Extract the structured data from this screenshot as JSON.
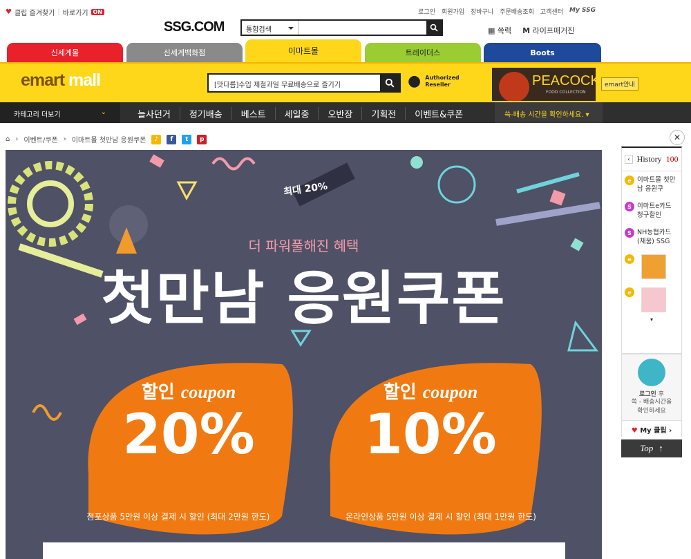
{
  "util": {
    "bookmark": "클립 즐겨찾기",
    "shortcut": "바로가기",
    "on": "ON",
    "links": [
      "로그인",
      "회원가입",
      "장바구니",
      "주문배송조회",
      "고객센터",
      "My SSG"
    ]
  },
  "header": {
    "logo": "SSG.COM",
    "search_select": "통합검색",
    "search_placeholder": "",
    "links": [
      "쓱력",
      "라이프매거진"
    ]
  },
  "tabs": [
    {
      "label": "신세계몰",
      "color": "#e8212b"
    },
    {
      "label": "신세계백화점",
      "color": "#8a8a8a"
    },
    {
      "label": "이마트몰",
      "color": "#ffd71a"
    },
    {
      "label": "트레이더스",
      "color": "#9acd32"
    },
    {
      "label": "Boots",
      "color": "#1d4a9a"
    }
  ],
  "emart": {
    "logo_a": "emart",
    "logo_b": "mall",
    "search": "[맛다름]수입 제철과일 무료배송으로 즐기기",
    "apple": [
      "Authorized",
      "Reseller"
    ],
    "peacock": "PEACOCK",
    "peacock_sub": "FOOD COLLECTION",
    "info": "emart안내"
  },
  "nav": {
    "category": "카테고리 더보기",
    "items": [
      "늘사던거",
      "정기배송",
      "베스트",
      "세일중",
      "오반장",
      "기획전",
      "이벤트&쿠폰"
    ],
    "ship": "쓱-배송 시간을 확인하세요."
  },
  "crumb": {
    "items": [
      "이벤트/쿠폰",
      "이마트몰 첫만남 응원쿠폰"
    ]
  },
  "banner": {
    "badge": "최대 20%",
    "sub": "더 파워풀해진 혜택",
    "title": "첫만남 응원쿠폰",
    "c1": {
      "pre": "할인",
      "word": "coupon",
      "pct": "20%",
      "desc": "점포상품 5만원 이상 결제 시 할인 (최대 2만원 한도)"
    },
    "c2": {
      "pre": "할인",
      "word": "coupon",
      "pct": "10%",
      "desc": "온라인상품 5만원 이상 결제 시 할인 (최대 1만원 한도)"
    }
  },
  "history": {
    "label": "History",
    "count": "100",
    "items": [
      "이마트몰 첫만남 응원쿠",
      "이마트e카드 청구할인",
      "NH농협카드(채움) SSG"
    ],
    "login": "로그인",
    "login_rest": "후",
    "login_desc": "쓱 - 배송시간을 확인하세요",
    "myclip": "My 클립",
    "top": "Top"
  }
}
